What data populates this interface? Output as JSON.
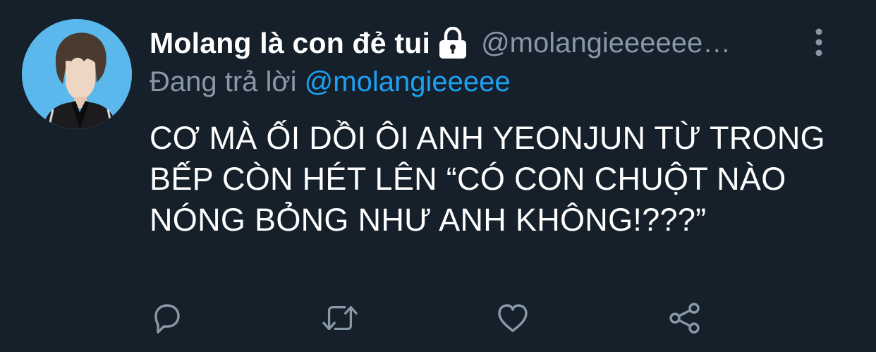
{
  "tweet": {
    "display_name": "Molang là con đẻ tui",
    "handle": "@molangieeeeeeeee",
    "reply_prefix": "Đang trả lời",
    "reply_to": "@molangieeeee",
    "text": "CƠ MÀ ỐI DỒI ÔI ANH YEONJUN TỪ TRONG BẾP CÒN HÉT LÊN “CÓ CON CHUỘT NÀO NÓNG BỎNG NHƯ ANH KHÔNG!???”"
  },
  "icons": {
    "lock": "lock-icon",
    "more": "more-vertical-icon",
    "reply": "reply-icon",
    "retweet": "retweet-icon",
    "like": "heart-icon",
    "share": "share-icon"
  },
  "colors": {
    "background": "#15202b",
    "secondary_text": "#8899a6",
    "link": "#1da1f2",
    "avatar_bg": "#5ab8ec"
  }
}
